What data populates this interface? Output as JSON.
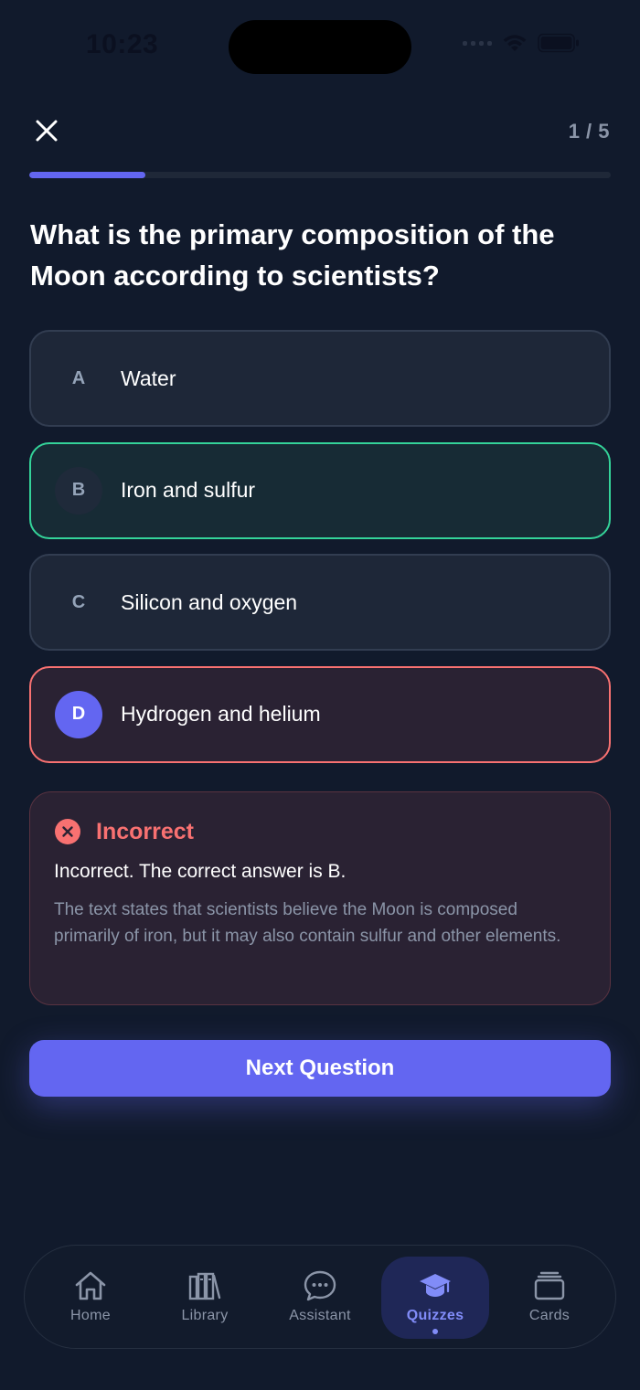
{
  "status_bar": {
    "time": "10:23"
  },
  "header": {
    "counter": "1 / 5",
    "progress": 0.2
  },
  "question": {
    "text": "What is the primary composition of the Moon according to scientists?"
  },
  "options": [
    {
      "letter": "A",
      "text": "Water",
      "state": "default"
    },
    {
      "letter": "B",
      "text": "Iron and sulfur",
      "state": "correct"
    },
    {
      "letter": "C",
      "text": "Silicon and oxygen",
      "state": "default"
    },
    {
      "letter": "D",
      "text": "Hydrogen and helium",
      "state": "selected-wrong"
    }
  ],
  "feedback": {
    "title": "Incorrect",
    "message": "Incorrect. The correct answer is B.",
    "explanation": "The text states that scientists believe the Moon is composed primarily of iron, but it may also contain sulfur and other elements."
  },
  "next_button": {
    "label": "Next Question"
  },
  "tab_bar": {
    "tabs": [
      {
        "label": "Home",
        "icon": "home-icon"
      },
      {
        "label": "Library",
        "icon": "library-icon"
      },
      {
        "label": "Assistant",
        "icon": "chat-icon"
      },
      {
        "label": "Quizzes",
        "icon": "graduation-cap-icon",
        "active": true
      },
      {
        "label": "Cards",
        "icon": "cards-icon"
      }
    ]
  },
  "colors": {
    "background": "#111a2c",
    "accent": "#6366f1",
    "correct": "#34d399",
    "incorrect": "#f87171"
  }
}
